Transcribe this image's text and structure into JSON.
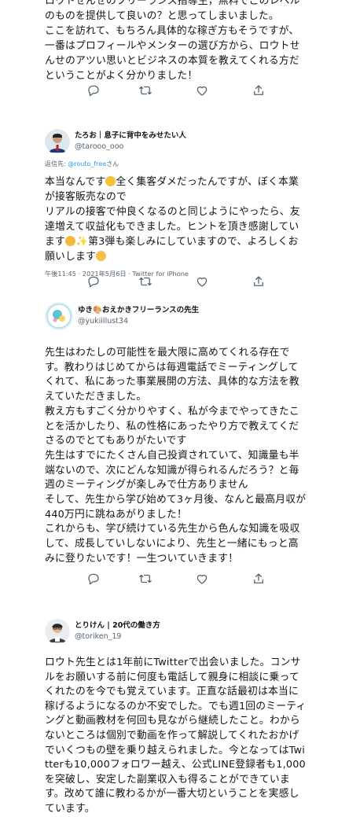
{
  "tweet0": {
    "text": "ロウトせんせのフリーランス指導生，無料でこのレベルのものを提供して良いの？と思ってしまいました。\nここを訪れて、もちろん具体的な稼ぎ方もそうですが、一番はプロフィールやメンターの選び方から、ロウトせんせのアツい思いとビジネスの本質を教えてくれる方だということがよく分かりました！"
  },
  "tweet1": {
    "display_name": "たろお｜息子に背中をみせたい人",
    "handle": "@tarooo_ooo",
    "reply_prefix": "返信先:",
    "reply_handle": "@routo_free",
    "reply_suffix": "さん",
    "text_a": "本当なんです",
    "text_b": "全く集客ダメだったんですが、ぼく本業が接客販売なので\nリアルの接客で仲良くなるのと同じようにやったら、友達増えて収益化もできました。ヒントを頂き感謝しています",
    "text_c": "第3弾も楽しみにしていますので、よろしくお願いします",
    "meta": "午後11:45 · 2021年5月6日 · Twitter for iPhone"
  },
  "tweet2": {
    "display_name": "ゆき🎨おえかきフリーランスの先生",
    "handle": "@yukiillust34",
    "text": "先生はわたしの可能性を最大限に高めてくれる存在です。教わりはじめてからは毎週電話でミーティングしてくれて、私にあった事業展開の方法、具体的な方法を教えていただきました。\n教え方もすごく分かりやすく、私が今までやってきたことを活かしたり、私の性格にあったやり方で教えてくださるのでとてもありがたいです\n先生はすでにたくさん自己投資されていて、知識量も半端ないので、次にどんな知識が得られるんだろう？と毎週のミーティングが楽しみで仕方ありません\nそして、先生から学び始めて3ヶ月後、なんと最高月収が440万円に跳ねあがりました！\nこれからも、学び続けている先生から色んな知識を吸収して、成長していしないにより、先生と一緒にもっと高みに登りたいです！一生ついていきます！"
  },
  "tweet3": {
    "display_name": "とりけん | 20代の働き方",
    "handle": "@toriken_19",
    "text": "ロウト先生とは1年前にTwitterで出会いました。コンサルをお願いする前に何度も電話して親身に相談に乗ってくれたのを今でも覚えています。正直な話最初は本当に稼げるようになるのか不安でした。でも週1回のミーティングと動画教材を何回も見ながら継続したこと。わからないところは個別で動画を作って解説してくれたおかげでいくつもの壁を乗り越えられました。今となってはTwitterも10,000フォロワー越え、公式LINE登録者も1,000を突破し、安定した副業収入も得ることができています。改めて誰に教わるかが一番大切ということを実感しています。"
  },
  "icons": [
    "reply-icon",
    "retweet-icon",
    "like-icon",
    "share-icon"
  ],
  "colors": {
    "link": "#1d9bf0",
    "muted": "#536471",
    "text": "#0f1419"
  }
}
